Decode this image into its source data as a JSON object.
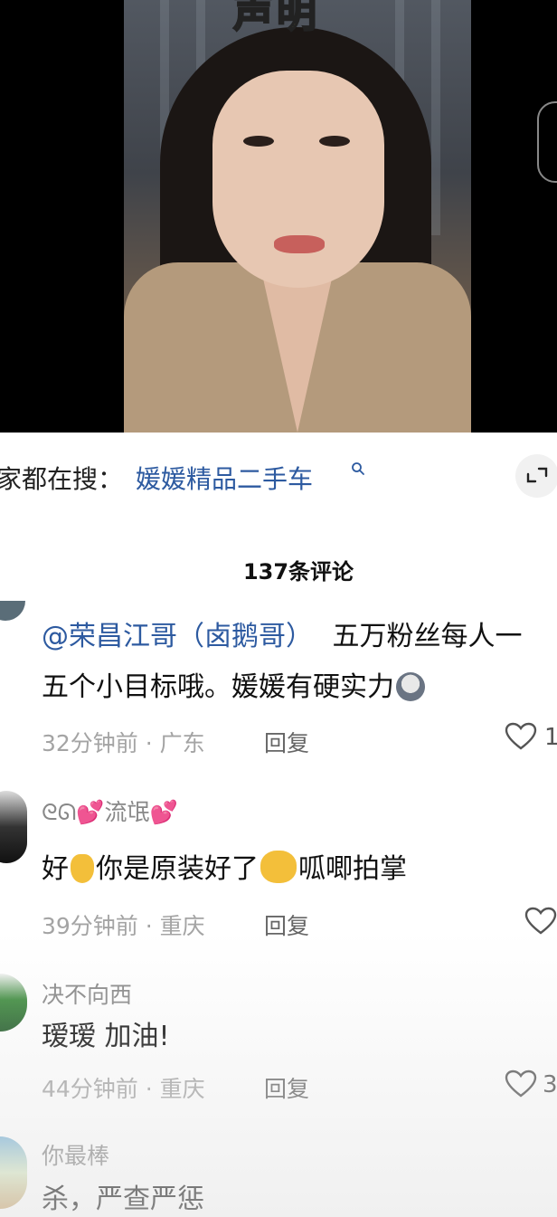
{
  "video": {
    "title_overlay": "声明"
  },
  "search": {
    "prefix": "家都在搜：",
    "query": "媛媛精品二手车"
  },
  "comments_header": "137条评论",
  "comments": [
    {
      "mention": "@荣昌江哥（卤鹅哥）",
      "text_line1": "五万粉丝每人一",
      "text_line2": "五个小目标哦。媛媛有硬实力",
      "time": "32分钟前 · 广东",
      "reply": "回复",
      "likes": "1"
    },
    {
      "name": "ᘓᘏ💕流氓💕",
      "text_a": "好",
      "text_b": "你是原装好了",
      "text_c": "呱唧拍掌",
      "time": "39分钟前 · 重庆",
      "reply": "回复",
      "likes": ""
    },
    {
      "name": "决不向西",
      "text": "瑷瑷 加油!",
      "time": "44分钟前 · 重庆",
      "reply": "回复",
      "likes": "3"
    },
    {
      "name": "你最棒",
      "text": "杀，严查严惩"
    }
  ],
  "colors": {
    "link": "#2d5aa0",
    "title_yellow": "#f6d85a"
  },
  "icons": {
    "search": "magnifier-icon",
    "expand": "expand-icon",
    "like": "heart-icon"
  }
}
